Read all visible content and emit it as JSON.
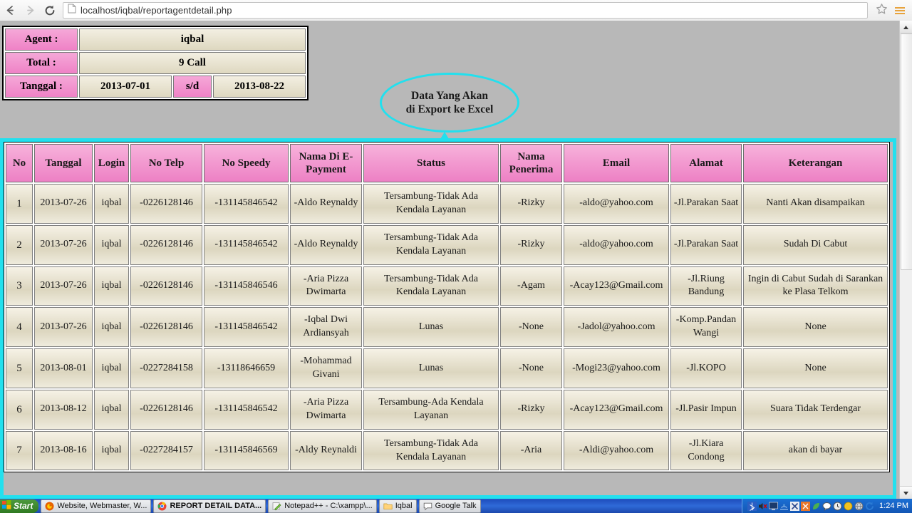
{
  "browser": {
    "back_icon": "back-arrow-icon",
    "forward_icon": "forward-arrow-icon",
    "reload_icon": "reload-icon",
    "url_host": "localhost",
    "url_path": "/iqbal/reportagentdetail.php",
    "url_full": "localhost/iqbal/reportagentdetail.php",
    "star_icon": "bookmark-star-icon",
    "menu_icon": "hamburger-menu-icon",
    "accent_orange": "#e8a33d"
  },
  "info": {
    "agent_label": "Agent :",
    "agent_value": "iqbal",
    "total_label": "Total :",
    "total_value": "9 Call",
    "tanggal_label": "Tanggal :",
    "date_from": "2013-07-01",
    "date_sep": "s/d",
    "date_to": "2013-08-22",
    "label_bg": "#ef82c6",
    "value_bg": "#ded8c0"
  },
  "callout": {
    "line1": "Data Yang Akan",
    "line2": "di Export ke Excel",
    "color": "#22e0ee"
  },
  "table": {
    "headers": [
      "No",
      "Tanggal",
      "Login",
      "No Telp",
      "No Speedy",
      "Nama Di E-Payment",
      "Status",
      "Nama Penerima",
      "Email",
      "Alamat",
      "Keterangan"
    ],
    "header_bg": "#ed80c4",
    "cell_bg": "#dcd6bf",
    "rows": [
      {
        "no": "1",
        "tanggal": "2013-07-26",
        "login": "iqbal",
        "no_telp": "-0226128146",
        "no_speedy": "-131145846542",
        "nama_epayment": "-Aldo Reynaldy",
        "status": "Tersambung-Tidak Ada Kendala Layanan",
        "nama_penerima": "-Rizky",
        "email": "-aldo@yahoo.com",
        "alamat": "-Jl.Parakan Saat",
        "keterangan": "Nanti Akan disampaikan"
      },
      {
        "no": "2",
        "tanggal": "2013-07-26",
        "login": "iqbal",
        "no_telp": "-0226128146",
        "no_speedy": "-131145846542",
        "nama_epayment": "-Aldo Reynaldy",
        "status": "Tersambung-Tidak Ada Kendala Layanan",
        "nama_penerima": "-Rizky",
        "email": "-aldo@yahoo.com",
        "alamat": "-Jl.Parakan Saat",
        "keterangan": "Sudah Di Cabut"
      },
      {
        "no": "3",
        "tanggal": "2013-07-26",
        "login": "iqbal",
        "no_telp": "-0226128146",
        "no_speedy": "-131145846546",
        "nama_epayment": "-Aria Pizza Dwimarta",
        "status": "Tersambung-Tidak Ada Kendala Layanan",
        "nama_penerima": "-Agam",
        "email": "-Acay123@Gmail.com",
        "alamat": "-Jl.Riung Bandung",
        "keterangan": "Ingin di Cabut Sudah di Sarankan ke Plasa Telkom"
      },
      {
        "no": "4",
        "tanggal": "2013-07-26",
        "login": "iqbal",
        "no_telp": "-0226128146",
        "no_speedy": "-131145846542",
        "nama_epayment": "-Iqbal Dwi Ardiansyah",
        "status": "Lunas",
        "nama_penerima": "-None",
        "email": "-Jadol@yahoo.com",
        "alamat": "-Komp.Pandan Wangi",
        "keterangan": "None"
      },
      {
        "no": "5",
        "tanggal": "2013-08-01",
        "login": "iqbal",
        "no_telp": "-0227284158",
        "no_speedy": "-13118646659",
        "nama_epayment": "-Mohammad Givani",
        "status": "Lunas",
        "nama_penerima": "-None",
        "email": "-Mogi23@yahoo.com",
        "alamat": "-Jl.KOPO",
        "keterangan": "None"
      },
      {
        "no": "6",
        "tanggal": "2013-08-12",
        "login": "iqbal",
        "no_telp": "-0226128146",
        "no_speedy": "-131145846542",
        "nama_epayment": "-Aria Pizza Dwimarta",
        "status": "Tersambung-Ada Kendala Layanan",
        "nama_penerima": "-Rizky",
        "email": "-Acay123@Gmail.com",
        "alamat": "-Jl.Pasir Impun",
        "keterangan": "Suara Tidak Terdengar"
      },
      {
        "no": "7",
        "tanggal": "2013-08-16",
        "login": "iqbal",
        "no_telp": "-0227284157",
        "no_speedy": "-131145846569",
        "nama_epayment": "-Aldy Reynaldi",
        "status": "Tersambung-Tidak Ada Kendala Layanan",
        "nama_penerima": "-Aria",
        "email": "-Aldi@yahoo.com",
        "alamat": "-Jl.Kiara Condong",
        "keterangan": "akan di bayar"
      }
    ]
  },
  "taskbar": {
    "start_label": "Start",
    "items": [
      {
        "label": "Website, Webmaster, W...",
        "icon": "firefox-icon"
      },
      {
        "label": "REPORT DETAIL DATA...",
        "icon": "chrome-icon"
      },
      {
        "label": "Notepad++ - C:\\xampp\\...",
        "icon": "notepad-plus-icon"
      },
      {
        "label": "Iqbal",
        "icon": "folder-icon"
      },
      {
        "label": "Google Talk",
        "icon": "google-talk-icon"
      }
    ],
    "tray_icons": [
      "bluetooth-icon",
      "volume-muted-icon",
      "display-icon",
      "network-icon",
      "x-tool-icon",
      "orange-app-icon",
      "green-leaf-icon",
      "chat-bubble-icon",
      "clock-app-icon",
      "yellow-circle-icon",
      "gray-globe-icon",
      "blue-sync-icon"
    ],
    "clock": "1:24 PM"
  }
}
